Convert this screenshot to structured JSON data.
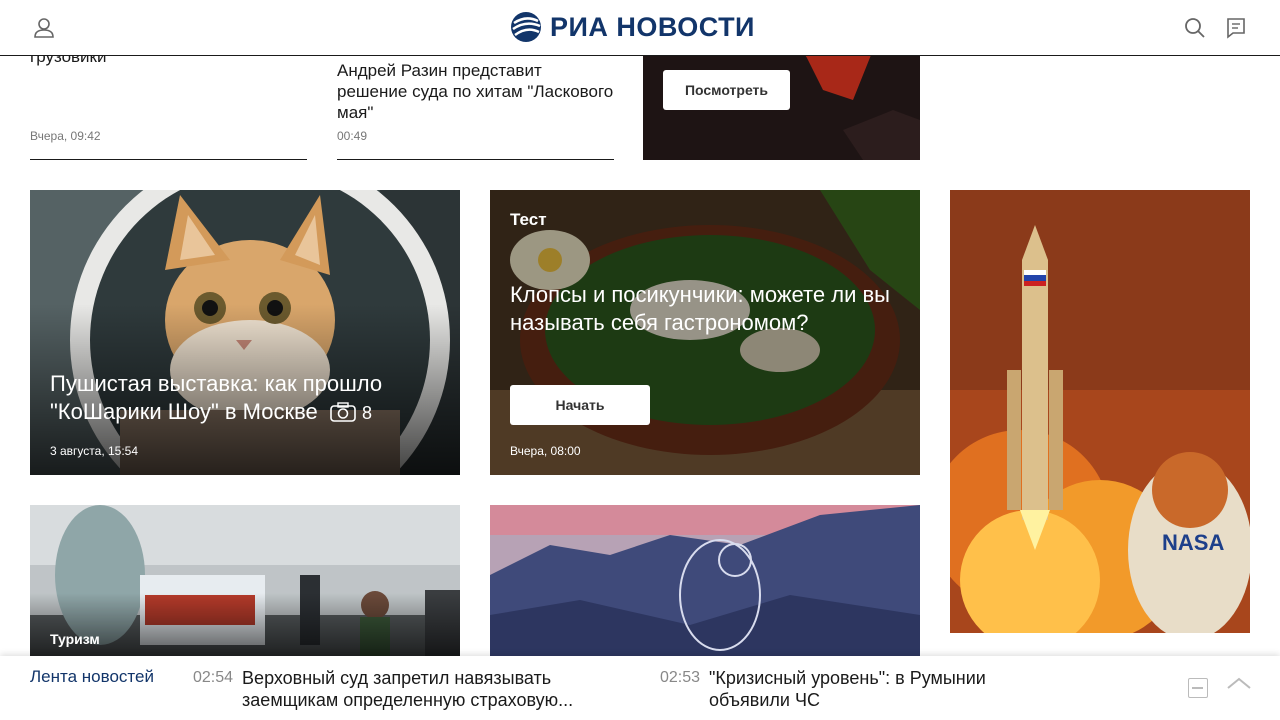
{
  "header": {
    "logo_text": "РИА НОВОСТИ",
    "brand_color": "#12356a",
    "icons": [
      "user-icon",
      "search-icon",
      "chat-icon"
    ]
  },
  "top_news": [
    {
      "title": "грузовики",
      "time": "Вчера, 09:42"
    },
    {
      "title": "Андрей Разин представит решение суда по хитам \"Ласкового мая\"",
      "time": "00:49"
    }
  ],
  "promo": {
    "button_label": "Посмотреть"
  },
  "cards": {
    "cat": {
      "title": "Пушистая выставка: как прошло \"КоШарики Шоу\" в Москве",
      "photo_count": "8",
      "time": "3 августа, 15:54"
    },
    "quiz": {
      "tag": "Тест",
      "title": "Клопсы и посикунчики: можете ли вы называть себя гастрономом?",
      "button_label": "Начать",
      "time": "Вчера, 08:00"
    },
    "tour": {
      "tag": "Туризм"
    }
  },
  "ticker": {
    "label": "Лента новостей",
    "items": [
      {
        "time": "02:54",
        "text": "Верховный суд запретил навязывать заемщикам определенную страховую..."
      },
      {
        "time": "02:53",
        "text": "\"Кризисный уровень\": в Румынии объявили ЧС"
      }
    ]
  }
}
